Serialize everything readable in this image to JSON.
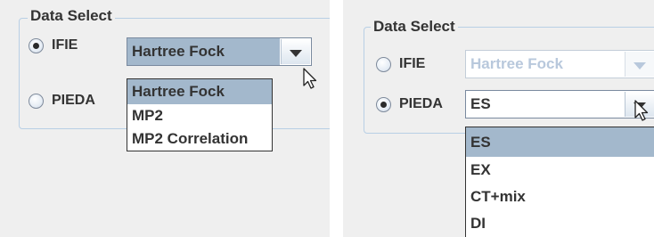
{
  "panels": [
    {
      "legend": "Data Select",
      "radios": [
        {
          "label": "IFIE",
          "checked": true
        },
        {
          "label": "PIEDA",
          "checked": false
        }
      ],
      "combo": {
        "value": "Hartree Fock",
        "enabled": true
      },
      "dropdown": {
        "items": [
          "Hartree Fock",
          "MP2",
          "MP2 Correlation"
        ],
        "selected_index": 0
      }
    },
    {
      "legend": "Data Select",
      "radios": [
        {
          "label": "IFIE",
          "checked": false
        },
        {
          "label": "PIEDA",
          "checked": true
        }
      ],
      "combo_ifie": {
        "value": "Hartree Fock",
        "enabled": false
      },
      "combo_pieda": {
        "value": "ES",
        "enabled": true
      },
      "dropdown": {
        "items": [
          "ES",
          "EX",
          "CT+mix",
          "DI"
        ],
        "selected_index": 0
      }
    }
  ],
  "icons": {
    "dropdown_arrow": "chevron-down-icon",
    "pointer": "mouse-cursor-icon"
  },
  "colors": {
    "selection": "#a3b8cc",
    "group_border": "#b8cfe5",
    "text": "#333333",
    "disabled_text": "#b8c8dc"
  }
}
